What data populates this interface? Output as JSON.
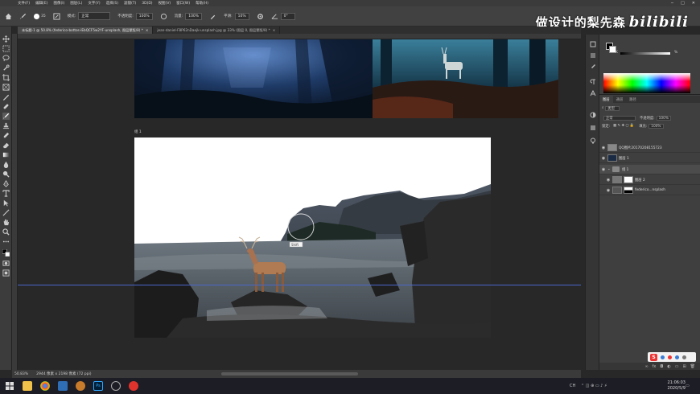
{
  "menubar": {
    "items": [
      "文件(F)",
      "编辑(E)",
      "图像(I)",
      "图层(L)",
      "文字(Y)",
      "选择(S)",
      "滤镜(T)",
      "3D(D)",
      "视图(V)",
      "窗口(W)",
      "帮助(H)"
    ],
    "window_controls": [
      "─",
      "□",
      "✕"
    ]
  },
  "options_bar": {
    "brush_size": "35",
    "mode_label": "模式:",
    "mode_value": "正常",
    "opacity_label": "不透明度:",
    "opacity_value": "100%",
    "flow_label": "流量:",
    "flow_value": "100%",
    "smoothing_label": "平滑:",
    "smoothing_value": "10%",
    "angle_value": "0°"
  },
  "watermark": {
    "text": "做设计的梨先森",
    "brand": "bilibili"
  },
  "tabs": [
    {
      "label": "未标题-1 @ 50.8% (federico-bottos-iEbQCF5w2YF-unsplash, 图层蒙版/8) *",
      "active": true
    },
    {
      "label": "jean-daniel-F8P62nDaejk-unsplash.jpg @ 33% (图层 0, 图层蒙版/8) *",
      "active": false
    }
  ],
  "canvas": {
    "group_label": "组 1",
    "brush_tooltip": "Shift"
  },
  "statusbar": {
    "zoom": "50.83%",
    "doc_size": "2944 像素 x 2198 像素 (72 ppi)"
  },
  "color_panel": {
    "k_label": "K",
    "k_value": "%"
  },
  "layers_panel": {
    "tabs": [
      {
        "label": "图层",
        "active": true
      },
      {
        "label": "通道",
        "active": false
      },
      {
        "label": "路径",
        "active": false
      }
    ],
    "filter_label": "类型",
    "blend_mode": "正常",
    "opacity_label": "不透明度:",
    "opacity_value": "100%",
    "lock_label": "锁定:",
    "fill_label": "填充:",
    "fill_value": "100%",
    "layers": [
      {
        "name": "QQ图片20170208155723",
        "kind": "image",
        "selected": false
      },
      {
        "name": "图层 1",
        "kind": "image",
        "selected": false
      },
      {
        "name": "组 1",
        "kind": "group",
        "selected": true
      },
      {
        "name": "图层 2",
        "kind": "masked",
        "selected": false
      },
      {
        "name": "federico...nsplash",
        "kind": "masked",
        "selected": false
      }
    ]
  },
  "taskbar": {
    "time": "21:06:03",
    "date": "2020/5/9",
    "lang": "CH"
  },
  "colors": {
    "accent_guide": "#4a66c8",
    "ps_blue": "#31a8ff",
    "panel_bg": "#3f3f3f"
  }
}
